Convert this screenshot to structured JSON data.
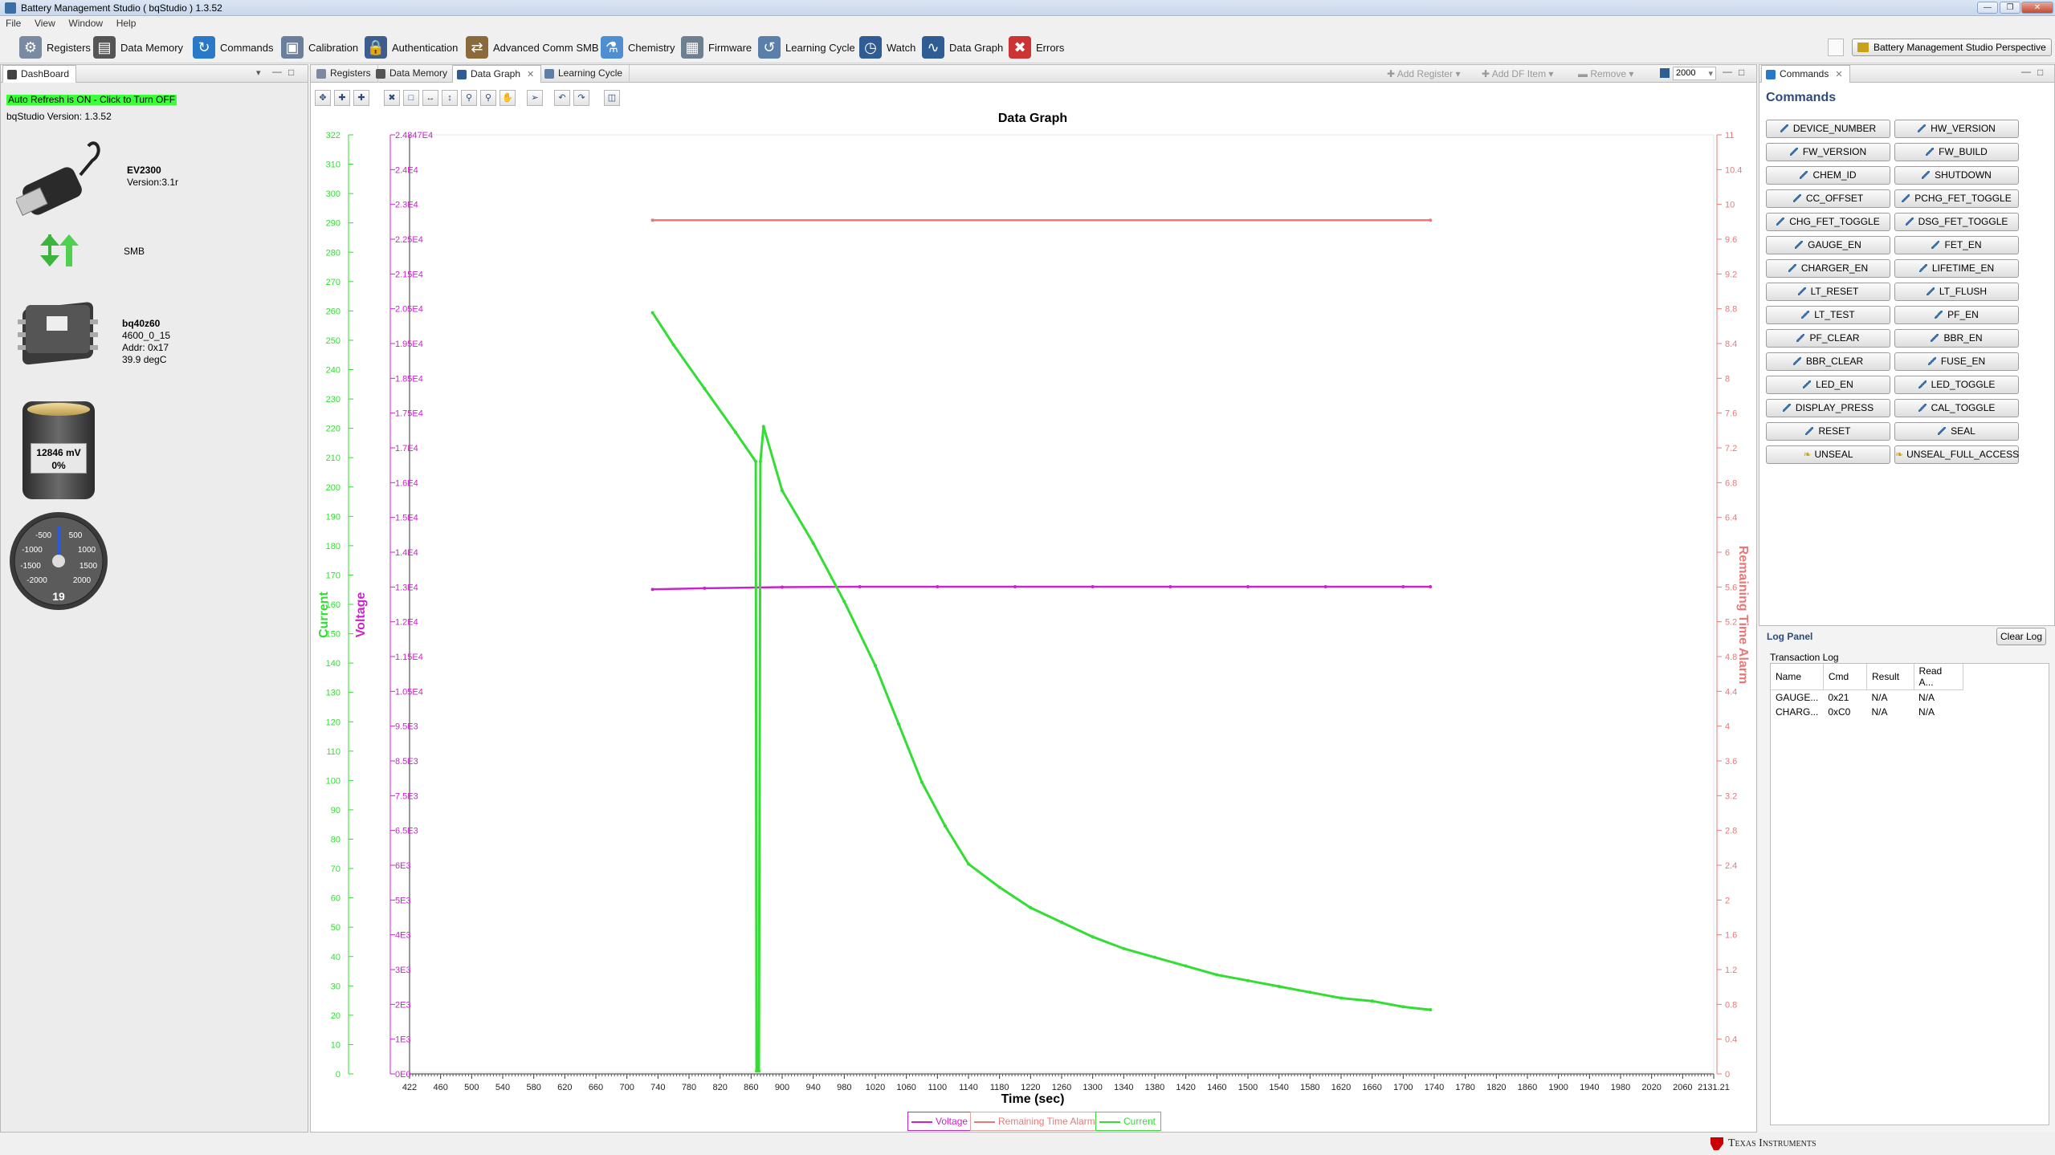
{
  "window": {
    "title": "Battery Management Studio ( bqStudio ) 1.3.52"
  },
  "menu": [
    "File",
    "View",
    "Window",
    "Help"
  ],
  "toolbar": {
    "items": [
      {
        "label": "Registers",
        "icon": "gear-icon",
        "color": "#7a8aa3"
      },
      {
        "label": "Data Memory",
        "icon": "memory-icon",
        "color": "#555555"
      },
      {
        "label": "Commands",
        "icon": "refresh-arrows-icon",
        "color": "#2a78c8"
      },
      {
        "label": "Calibration",
        "icon": "calibration-icon",
        "color": "#6b7f9c"
      },
      {
        "label": "Authentication",
        "icon": "lock-person-icon",
        "color": "#3e5d8f"
      },
      {
        "label": "Advanced Comm SMB",
        "icon": "comm-icon",
        "color": "#8a6a3a"
      },
      {
        "label": "Chemistry",
        "icon": "flask-icon",
        "color": "#4f8fd1"
      },
      {
        "label": "Firmware",
        "icon": "chip-icon",
        "color": "#6f7f92"
      },
      {
        "label": "Learning Cycle",
        "icon": "learning-icon",
        "color": "#5a7fa8"
      },
      {
        "label": "Watch",
        "icon": "watch-icon",
        "color": "#2f5d93"
      },
      {
        "label": "Data Graph",
        "icon": "graph-icon",
        "color": "#2f5d93"
      },
      {
        "label": "Errors",
        "icon": "error-icon",
        "color": "#cc3333"
      }
    ],
    "perspective": "Battery Management Studio Perspective"
  },
  "dashboard": {
    "tab": "DashBoard",
    "auto_refresh": "Auto Refresh is ON - Click to Turn OFF",
    "version_line": "bqStudio Version:  1.3.52",
    "adapter": {
      "name": "EV2300",
      "version": "Version:3.1r"
    },
    "bus": "SMB",
    "device": {
      "name": "bq40z60",
      "fw": "4600_0_15",
      "addr": "Addr: 0x17",
      "temp": "39.9 degC"
    },
    "battery": {
      "voltage": "12846 mV",
      "soc": "0%"
    },
    "gauge": {
      "value": "19",
      "ticks": [
        "-500",
        "500",
        "-1000",
        "1000",
        "-1500",
        "1500",
        "-2000",
        "2000"
      ],
      "reading": 19
    }
  },
  "graph_tabs": [
    "Registers",
    "Data Memory",
    "Data Graph",
    "Learning Cycle"
  ],
  "graph_toolbar": {
    "add_register": "Add Register",
    "add_df_item": "Add DF Item",
    "remove": "Remove",
    "interval": "2000"
  },
  "chart_data": {
    "type": "line",
    "title": "Data Graph",
    "xlabel": "Time (sec)",
    "xlim": [
      422,
      2131.21
    ],
    "x_ticks": [
      "422",
      "460",
      "500",
      "540",
      "580",
      "620",
      "660",
      "700",
      "740",
      "780",
      "820",
      "860",
      "900",
      "940",
      "980",
      "1020",
      "1060",
      "1100",
      "1140",
      "1180",
      "1220",
      "1260",
      "1300",
      "1340",
      "1380",
      "1420",
      "1460",
      "1500",
      "1540",
      "1580",
      "1620",
      "1660",
      "1700",
      "1740",
      "1780",
      "1820",
      "1860",
      "1900",
      "1940",
      "1980",
      "2020",
      "2060",
      "2131.21"
    ],
    "axes": [
      {
        "label": "Current",
        "color": "#33dd33",
        "ylim": [
          0,
          322
        ],
        "ticks": [
          "0",
          "10",
          "20",
          "30",
          "40",
          "50",
          "60",
          "70",
          "80",
          "90",
          "100",
          "110",
          "120",
          "130",
          "140",
          "150",
          "160",
          "170",
          "180",
          "190",
          "200",
          "210",
          "220",
          "230",
          "240",
          "250",
          "260",
          "270",
          "280",
          "290",
          "300",
          "310",
          "322"
        ]
      },
      {
        "label": "Voltage",
        "color": "#cc22cc",
        "ylim": [
          0,
          24847
        ],
        "ticks": [
          "0E0",
          "1E3",
          "2E3",
          "3E3",
          "4E3",
          "5E3",
          "6E3",
          "6.5E3",
          "7.5E3",
          "8.5E3",
          "9.5E3",
          "1.05E4",
          "1.15E4",
          "1.2E4",
          "1.3E4",
          "1.4E4",
          "1.5E4",
          "1.6E4",
          "1.7E4",
          "1.75E4",
          "1.85E4",
          "1.95E4",
          "2.05E4",
          "2.15E4",
          "2.25E4",
          "2.3E4",
          "2.4E4",
          "2.4847E4"
        ]
      },
      {
        "label": "Remaining Time Alarm",
        "color": "#e87878",
        "ylim": [
          0,
          11
        ],
        "ticks": [
          "0",
          "0.4",
          "0.8",
          "1.2",
          "1.6",
          "2",
          "2.4",
          "2.8",
          "3.2",
          "3.6",
          "4",
          "4.4",
          "4.8",
          "5.2",
          "5.6",
          "6",
          "6.4",
          "6.8",
          "7.2",
          "7.6",
          "8",
          "8.4",
          "8.8",
          "9.2",
          "9.6",
          "10",
          "10.4",
          "11"
        ]
      }
    ],
    "series": [
      {
        "name": "Voltage",
        "color": "#cc22cc",
        "axis": 1,
        "x": [
          733,
          800,
          900,
          1000,
          1100,
          1200,
          1300,
          1400,
          1500,
          1600,
          1700,
          1735
        ],
        "values": [
          12820,
          12850,
          12880,
          12890,
          12890,
          12890,
          12890,
          12890,
          12890,
          12890,
          12890,
          12890
        ]
      },
      {
        "name": "Remaining Time Alarm",
        "color": "#e87878",
        "axis": 2,
        "x": [
          733,
          1735
        ],
        "values": [
          10,
          10
        ]
      },
      {
        "name": "Current",
        "color": "#33dd33",
        "axis": 0,
        "x": [
          733,
          760,
          800,
          840,
          866,
          867,
          870,
          872,
          876,
          900,
          940,
          980,
          1020,
          1050,
          1080,
          1110,
          1140,
          1180,
          1220,
          1260,
          1300,
          1340,
          1380,
          1420,
          1460,
          1500,
          1540,
          1580,
          1620,
          1660,
          1700,
          1735
        ],
        "values": [
          261,
          250,
          235,
          220,
          210,
          1,
          1,
          210,
          222,
          200,
          182,
          162,
          140,
          120,
          100,
          85,
          72,
          64,
          57,
          52,
          47,
          43,
          40,
          37,
          34,
          32,
          30,
          28,
          26,
          25,
          23,
          22
        ]
      }
    ],
    "legend": [
      "Voltage",
      "Remaining Time Alarm",
      "Current"
    ]
  },
  "commands": {
    "tab": "Commands",
    "title": "Commands",
    "buttons": [
      "DEVICE_NUMBER",
      "HW_VERSION",
      "FW_VERSION",
      "FW_BUILD",
      "CHEM_ID",
      "SHUTDOWN",
      "CC_OFFSET",
      "PCHG_FET_TOGGLE",
      "CHG_FET_TOGGLE",
      "DSG_FET_TOGGLE",
      "GAUGE_EN",
      "FET_EN",
      "CHARGER_EN",
      "LIFETIME_EN",
      "LT_RESET",
      "LT_FLUSH",
      "LT_TEST",
      "PF_EN",
      "PF_CLEAR",
      "BBR_EN",
      "BBR_CLEAR",
      "FUSE_EN",
      "LED_EN",
      "LED_TOGGLE",
      "DISPLAY_PRESS",
      "CAL_TOGGLE",
      "RESET",
      "SEAL",
      "UNSEAL",
      "UNSEAL_FULL_ACCESS"
    ]
  },
  "log": {
    "title": "Log Panel",
    "clear": "Clear Log",
    "group": "Transaction Log",
    "columns": [
      "Name",
      "Cmd",
      "Result",
      "Read A..."
    ],
    "rows": [
      [
        "GAUGE...",
        "0x21",
        "N/A",
        "N/A"
      ],
      [
        "CHARG...",
        "0xC0",
        "N/A",
        "N/A"
      ]
    ]
  },
  "status": {
    "brand": "Texas Instruments"
  }
}
